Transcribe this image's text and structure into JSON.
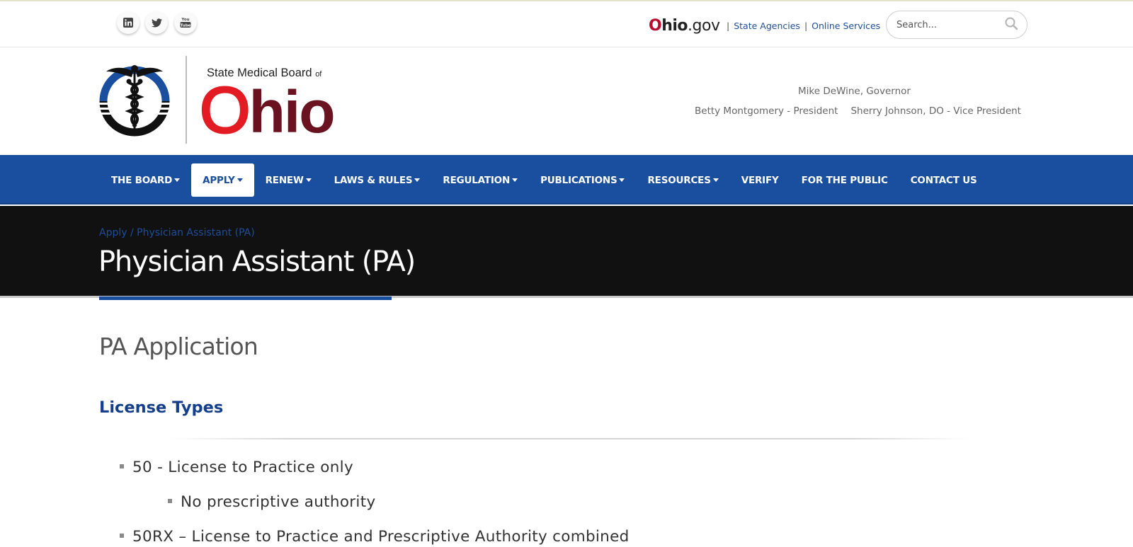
{
  "topbar": {
    "social": [
      {
        "name": "linkedin-icon"
      },
      {
        "name": "twitter-icon"
      },
      {
        "name": "youtube-icon"
      }
    ],
    "ohio_gov": {
      "o": "O",
      "hio": "hio",
      "gov": ".gov"
    },
    "links": [
      {
        "label": "State Agencies"
      },
      {
        "label": "Online Services"
      }
    ],
    "separator": "|",
    "search_placeholder": "Search..."
  },
  "brand": {
    "title": "State Medical Board",
    "title_of": "of",
    "logo_o": "O",
    "logo_rest": "hio",
    "governor": "Mike DeWine, Governor",
    "president": "Betty Montgomery - President",
    "vice_president": "Sherry Johnson, DO - Vice President"
  },
  "nav": {
    "items": [
      {
        "label": "THE BOARD",
        "dropdown": true
      },
      {
        "label": "APPLY",
        "dropdown": true,
        "active": true
      },
      {
        "label": "RENEW",
        "dropdown": true
      },
      {
        "label": "LAWS & RULES",
        "dropdown": true
      },
      {
        "label": "REGULATION",
        "dropdown": true
      },
      {
        "label": "PUBLICATIONS",
        "dropdown": true
      },
      {
        "label": "RESOURCES",
        "dropdown": true
      },
      {
        "label": "VERIFY",
        "dropdown": false
      },
      {
        "label": "FOR THE PUBLIC",
        "dropdown": false
      },
      {
        "label": "CONTACT US",
        "dropdown": false
      }
    ]
  },
  "breadcrumb": {
    "parent": "Apply",
    "separator": " / ",
    "current": "Physician Assistant (PA)"
  },
  "page_title": "Physician Assistant (PA)",
  "content": {
    "section_title": "PA Application",
    "subhead": "License Types",
    "list": [
      {
        "text": "50 - License to Practice only",
        "level": 1
      },
      {
        "text": "No prescriptive authority",
        "level": 2
      },
      {
        "text": "50RX – License to Practice and Prescriptive Authority combined",
        "level": 1
      }
    ]
  },
  "colors": {
    "nav_blue": "#1a4e9e",
    "title_band": "#111111",
    "ohio_red": "#e31b23",
    "ohio_maroon": "#6b1220",
    "subhead_blue": "#143f8a"
  }
}
